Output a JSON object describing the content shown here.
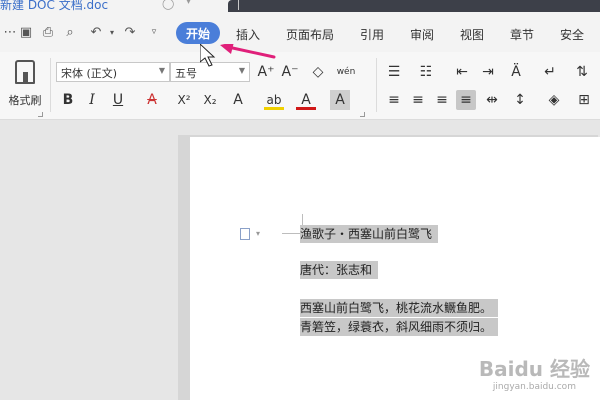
{
  "titlebar": {
    "doc_tab": "新建 DOC 文档.doc"
  },
  "menu": [
    "开始",
    "插入",
    "页面布局",
    "引用",
    "审阅",
    "视图",
    "章节",
    "安全"
  ],
  "menu_active_index": 0,
  "ribbon": {
    "format_painter": "格式刷",
    "font_name": "宋体 (正文)",
    "font_size": "五号",
    "bold": "B",
    "italic": "I",
    "underline": "U",
    "strike": "A",
    "superscript": "X²",
    "subscript": "X₂",
    "font_grow": "A⁺",
    "font_shrink": "A⁻",
    "text_effect": "A",
    "highlight": "ab",
    "font_color": "A",
    "char_shading": "A",
    "phonetic": "wén"
  },
  "colors": {
    "accent": "#4a7ed9",
    "arrow": "#e0207a",
    "highlight": "#c8c8c8"
  },
  "document": {
    "lines": [
      "渔歌子・西塞山前白鹭飞",
      "唐代：张志和",
      "西塞山前白鹭飞，桃花流水鳜鱼肥。",
      "青箬笠，绿蓑衣，斜风细雨不须归。"
    ]
  },
  "watermark": {
    "main": "Baidu 经验",
    "sub": "jingyan.baidu.com"
  }
}
